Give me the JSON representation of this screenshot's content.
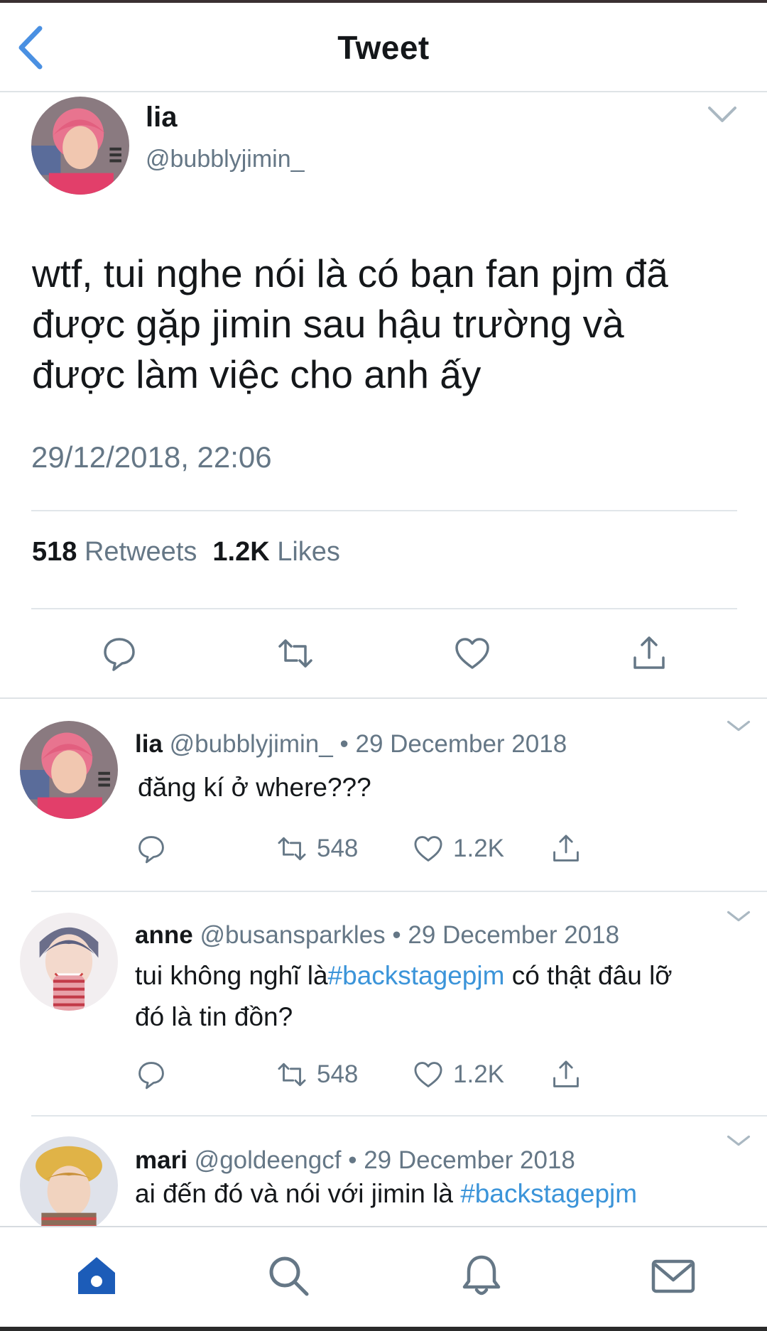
{
  "header": {
    "title": "Tweet",
    "back_icon": "chevron-left-icon"
  },
  "main_tweet": {
    "name": "lia",
    "handle": "@bubblyjimin_",
    "text_lines": [
      "wtf, tui nghe nói là có bạn fan pjm đã",
      "được gặp jimin sau hậu trường và",
      "được làm việc cho anh ấy"
    ],
    "timestamp": "29/12/2018, 22:06",
    "retweets_count": "518",
    "retweets_label": "Retweets",
    "likes_count": "1.2K",
    "likes_label": "Likes",
    "actions": [
      "reply-icon",
      "retweet-icon",
      "heart-icon",
      "share-icon"
    ]
  },
  "replies": [
    {
      "name": "lia",
      "handle": "@bubblyjimin_",
      "sep": "•",
      "date": "29 December 2018",
      "text_a": "đăng kí ở where???",
      "retweets": "548",
      "likes": "1.2K"
    },
    {
      "name": "anne",
      "handle": "@busansparkles",
      "sep": "•",
      "date": "29 December 2018",
      "text_a": "tui không nghĩ là",
      "hashtag": "#backstagepjm",
      "text_b": " có thật đâu lỡ",
      "text_c": "đó là tin đồn?",
      "retweets": "548",
      "likes": "1.2K"
    },
    {
      "name": "mari",
      "handle": "@goldeengcf",
      "sep": "•",
      "date": "29 December 2018",
      "text_a": "ai đến đó và nói với jimin là ",
      "hashtag": "#backstagepjm"
    }
  ],
  "bottom_nav": [
    "home-icon",
    "search-icon",
    "notifications-icon",
    "messages-icon"
  ],
  "colors": {
    "accent_blue": "#1da1f2",
    "hashtag_blue": "#3b94d9",
    "secondary_text": "#657786",
    "nav_active": "#1c5cb8"
  }
}
